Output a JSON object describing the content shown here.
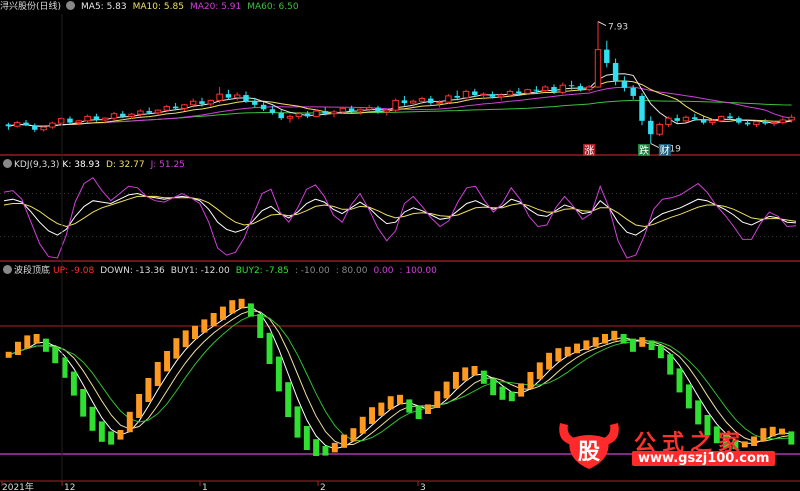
{
  "colors": {
    "bg": "#000000",
    "separator": "#b0202a",
    "ma5": "#e8e8e8",
    "ma10": "#f0e060",
    "ma20": "#d040d8",
    "ma60": "#40c040",
    "up": "#ff3030",
    "down": "#30e0f0",
    "kdj_k": "#ffffff",
    "kdj_d": "#f0e060",
    "kdj_j": "#d040d8",
    "wave_up": "#ff9a20",
    "wave_down": "#30e030",
    "level_line": "#d040d8"
  },
  "price_panel": {
    "name": "浔兴股份(日线)",
    "indicators": [
      {
        "label": "MA5: 5.83",
        "color": "#e8e8e8"
      },
      {
        "label": "MA10: 5.85",
        "color": "#f0e060"
      },
      {
        "label": "MA20: 5.91",
        "color": "#d040d8"
      },
      {
        "label": "MA60: 6.50",
        "color": "#40c040"
      }
    ],
    "high_label": "7.93",
    "low_label": "5.19",
    "tag_up": "涨",
    "tag_down": "跌",
    "tag_fin": "财"
  },
  "kdj_panel": {
    "name": "KDJ(9,3,3)",
    "indicators": [
      {
        "label": "K: 38.93",
        "color": "#ffffff"
      },
      {
        "label": "D: 32.77",
        "color": "#f0e060"
      },
      {
        "label": "J: 51.25",
        "color": "#d040d8"
      }
    ]
  },
  "wave_panel": {
    "name": "波段顶底",
    "indicators": [
      {
        "label": "UP: -9.08",
        "color": "#ff3030"
      },
      {
        "label": "DOWN: -13.36",
        "color": "#dddddd"
      },
      {
        "label": "BUY1: -12.00",
        "color": "#dddddd"
      },
      {
        "label": "BUY2: -7.85",
        "color": "#30e030"
      },
      {
        "label": ": -10.00",
        "color": "#888888"
      },
      {
        "label": ": 80.00",
        "color": "#888888"
      },
      {
        "label": "0.00",
        "color": "#d040d8"
      },
      {
        "label": ": 100.00",
        "color": "#d040d8"
      }
    ]
  },
  "time_axis": {
    "labels": [
      "2021年",
      "12",
      "1",
      "2",
      "3"
    ]
  },
  "watermark": {
    "logo_char": "股",
    "text": "公式之家",
    "url": "www.gszj100.com"
  },
  "chart_data": [
    {
      "type": "candlestick",
      "title": "浔兴股份(日线)",
      "annotations": [
        "7.93",
        "5.19"
      ],
      "ylim": [
        5.0,
        8.1
      ],
      "candles": [
        [
          5.62,
          5.66,
          5.5,
          5.58
        ],
        [
          5.58,
          5.7,
          5.55,
          5.66
        ],
        [
          5.66,
          5.72,
          5.58,
          5.6
        ],
        [
          5.6,
          5.64,
          5.45,
          5.5
        ],
        [
          5.5,
          5.58,
          5.46,
          5.56
        ],
        [
          5.56,
          5.68,
          5.52,
          5.65
        ],
        [
          5.65,
          5.78,
          5.6,
          5.75
        ],
        [
          5.75,
          5.8,
          5.62,
          5.66
        ],
        [
          5.66,
          5.72,
          5.6,
          5.7
        ],
        [
          5.7,
          5.84,
          5.66,
          5.8
        ],
        [
          5.8,
          5.86,
          5.68,
          5.72
        ],
        [
          5.72,
          5.78,
          5.64,
          5.76
        ],
        [
          5.76,
          5.9,
          5.72,
          5.86
        ],
        [
          5.86,
          5.92,
          5.76,
          5.8
        ],
        [
          5.8,
          5.88,
          5.74,
          5.85
        ],
        [
          5.85,
          5.96,
          5.8,
          5.92
        ],
        [
          5.92,
          6.0,
          5.84,
          5.88
        ],
        [
          5.88,
          5.96,
          5.82,
          5.94
        ],
        [
          5.94,
          6.06,
          5.9,
          6.02
        ],
        [
          6.02,
          6.1,
          5.94,
          5.98
        ],
        [
          5.98,
          6.08,
          5.92,
          6.06
        ],
        [
          6.06,
          6.2,
          6.0,
          6.14
        ],
        [
          6.14,
          6.22,
          6.02,
          6.08
        ],
        [
          6.08,
          6.18,
          6.02,
          6.16
        ],
        [
          6.16,
          6.46,
          6.1,
          6.3
        ],
        [
          6.3,
          6.4,
          6.18,
          6.22
        ],
        [
          6.22,
          6.34,
          6.16,
          6.28
        ],
        [
          6.28,
          6.36,
          6.1,
          6.14
        ],
        [
          6.14,
          6.22,
          6.0,
          6.06
        ],
        [
          6.06,
          6.12,
          5.92,
          5.96
        ],
        [
          5.96,
          6.04,
          5.84,
          5.88
        ],
        [
          5.88,
          5.94,
          5.72,
          5.76
        ],
        [
          5.76,
          5.84,
          5.66,
          5.8
        ],
        [
          5.8,
          5.9,
          5.74,
          5.86
        ],
        [
          5.86,
          5.92,
          5.76,
          5.8
        ],
        [
          5.8,
          5.96,
          5.78,
          5.92
        ],
        [
          5.92,
          6.0,
          5.82,
          5.86
        ],
        [
          5.86,
          5.94,
          5.78,
          5.9
        ],
        [
          5.9,
          6.02,
          5.86,
          5.98
        ],
        [
          5.98,
          6.04,
          5.88,
          5.92
        ],
        [
          5.92,
          5.98,
          5.84,
          5.96
        ],
        [
          5.96,
          6.06,
          5.9,
          6.0
        ],
        [
          6.0,
          6.04,
          5.86,
          5.9
        ],
        [
          5.9,
          5.96,
          5.82,
          5.94
        ],
        [
          5.94,
          6.2,
          5.9,
          6.16
        ],
        [
          6.16,
          6.26,
          6.04,
          6.1
        ],
        [
          6.1,
          6.18,
          6.02,
          6.14
        ],
        [
          6.14,
          6.24,
          6.08,
          6.2
        ],
        [
          6.2,
          6.26,
          6.06,
          6.1
        ],
        [
          6.1,
          6.16,
          6.0,
          6.12
        ],
        [
          6.12,
          6.3,
          6.08,
          6.26
        ],
        [
          6.26,
          6.38,
          6.16,
          6.22
        ],
        [
          6.22,
          6.4,
          6.18,
          6.36
        ],
        [
          6.36,
          6.42,
          6.24,
          6.28
        ],
        [
          6.28,
          6.34,
          6.18,
          6.3
        ],
        [
          6.3,
          6.36,
          6.2,
          6.24
        ],
        [
          6.24,
          6.32,
          6.16,
          6.28
        ],
        [
          6.28,
          6.4,
          6.24,
          6.36
        ],
        [
          6.36,
          6.44,
          6.26,
          6.32
        ],
        [
          6.32,
          6.42,
          6.28,
          6.4
        ],
        [
          6.4,
          6.48,
          6.32,
          6.38
        ],
        [
          6.38,
          6.5,
          6.34,
          6.46
        ],
        [
          6.46,
          6.52,
          6.3,
          6.34
        ],
        [
          6.34,
          6.56,
          6.3,
          6.5
        ],
        [
          6.5,
          6.6,
          6.4,
          6.48
        ],
        [
          6.48,
          6.54,
          6.36,
          6.4
        ],
        [
          6.4,
          6.5,
          6.36,
          6.46
        ],
        [
          6.46,
          7.93,
          6.44,
          7.3
        ],
        [
          7.3,
          7.5,
          6.9,
          7.0
        ],
        [
          7.0,
          7.1,
          6.5,
          6.6
        ],
        [
          6.6,
          6.7,
          6.36,
          6.44
        ],
        [
          6.44,
          6.5,
          6.18,
          6.26
        ],
        [
          6.26,
          6.32,
          5.6,
          5.7
        ],
        [
          5.7,
          5.8,
          5.19,
          5.4
        ],
        [
          5.4,
          5.66,
          5.36,
          5.62
        ],
        [
          5.62,
          5.8,
          5.56,
          5.76
        ],
        [
          5.76,
          5.84,
          5.64,
          5.7
        ],
        [
          5.7,
          5.82,
          5.66,
          5.78
        ],
        [
          5.78,
          5.86,
          5.7,
          5.74
        ],
        [
          5.74,
          5.8,
          5.62,
          5.66
        ],
        [
          5.66,
          5.74,
          5.6,
          5.7
        ],
        [
          5.7,
          5.82,
          5.66,
          5.8
        ],
        [
          5.8,
          5.88,
          5.72,
          5.76
        ],
        [
          5.76,
          5.8,
          5.62,
          5.66
        ],
        [
          5.66,
          5.72,
          5.58,
          5.62
        ],
        [
          5.62,
          5.7,
          5.56,
          5.68
        ],
        [
          5.68,
          5.74,
          5.6,
          5.64
        ],
        [
          5.64,
          5.7,
          5.58,
          5.66
        ],
        [
          5.66,
          5.78,
          5.62,
          5.72
        ],
        [
          5.72,
          5.84,
          5.66,
          5.78
        ]
      ]
    },
    {
      "type": "line",
      "title": "KDJ(9,3,3)",
      "ylim": [
        -10,
        110
      ],
      "series": [
        {
          "name": "K",
          "values": [
            70,
            72,
            68,
            55,
            40,
            28,
            22,
            30,
            48,
            62,
            70,
            68,
            66,
            72,
            78,
            80,
            76,
            74,
            72,
            74,
            76,
            74,
            70,
            58,
            40,
            30,
            26,
            30,
            42,
            56,
            62,
            52,
            46,
            54,
            66,
            72,
            68,
            58,
            52,
            60,
            68,
            60,
            48,
            38,
            40,
            54,
            60,
            56,
            50,
            44,
            46,
            56,
            66,
            70,
            64,
            58,
            62,
            72,
            68,
            58,
            50,
            48,
            56,
            64,
            60,
            52,
            54,
            70,
            60,
            40,
            26,
            22,
            30,
            44,
            52,
            56,
            60,
            66,
            72,
            70,
            64,
            58,
            50,
            40,
            36,
            42,
            48,
            46,
            40,
            39
          ]
        },
        {
          "name": "D",
          "values": [
            64,
            66,
            66,
            62,
            55,
            46,
            38,
            34,
            38,
            46,
            54,
            60,
            64,
            68,
            72,
            76,
            76,
            76,
            74,
            74,
            74,
            74,
            72,
            67,
            58,
            48,
            40,
            36,
            38,
            44,
            50,
            51,
            49,
            51,
            56,
            62,
            64,
            62,
            58,
            58,
            62,
            61,
            56,
            50,
            46,
            48,
            52,
            53,
            52,
            49,
            48,
            50,
            55,
            60,
            61,
            60,
            60,
            64,
            66,
            63,
            58,
            54,
            54,
            58,
            59,
            56,
            55,
            60,
            60,
            53,
            44,
            36,
            34,
            37,
            42,
            47,
            51,
            56,
            61,
            64,
            64,
            62,
            58,
            52,
            46,
            44,
            45,
            45,
            43,
            41
          ]
        },
        {
          "name": "J",
          "values": [
            82,
            84,
            72,
            41,
            10,
            -8,
            -10,
            22,
            68,
            94,
            102,
            84,
            70,
            80,
            90,
            88,
            76,
            70,
            68,
            74,
            80,
            74,
            66,
            40,
            4,
            -6,
            -2,
            18,
            50,
            80,
            86,
            54,
            40,
            60,
            86,
            92,
            76,
            50,
            40,
            64,
            80,
            58,
            32,
            14,
            28,
            66,
            76,
            62,
            46,
            34,
            42,
            68,
            88,
            90,
            70,
            54,
            66,
            88,
            72,
            48,
            34,
            36,
            60,
            76,
            62,
            44,
            52,
            90,
            60,
            14,
            -10,
            -6,
            22,
            58,
            72,
            74,
            78,
            86,
            94,
            82,
            64,
            50,
            34,
            16,
            16,
            38,
            54,
            48,
            34,
            35
          ]
        }
      ]
    },
    {
      "type": "bar",
      "title": "波段顶底",
      "ylim": [
        -15,
        110
      ],
      "reference_lines": [
        80,
        0
      ],
      "series": [
        {
          "name": "wave",
          "values": [
            62,
            66,
            70,
            72,
            68,
            62,
            54,
            44,
            32,
            22,
            14,
            10,
            12,
            20,
            30,
            40,
            50,
            58,
            66,
            72,
            76,
            80,
            84,
            88,
            92,
            94,
            90,
            80,
            66,
            50,
            34,
            20,
            10,
            4,
            2,
            4,
            8,
            12,
            18,
            24,
            28,
            32,
            34,
            30,
            26,
            28,
            34,
            40,
            46,
            50,
            52,
            48,
            42,
            38,
            36,
            40,
            46,
            52,
            58,
            62,
            64,
            66,
            68,
            70,
            72,
            74,
            72,
            68,
            70,
            68,
            64,
            56,
            46,
            36,
            26,
            18,
            12,
            8,
            6,
            6,
            8,
            12,
            14,
            14,
            10
          ]
        }
      ]
    }
  ]
}
